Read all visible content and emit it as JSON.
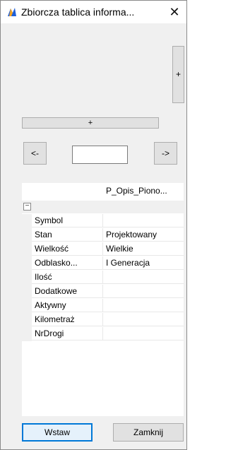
{
  "window": {
    "title": "Zbiorcza tablica informa...",
    "close_glyph": "✕",
    "icon": "app-sign-icon"
  },
  "controls": {
    "plus_right_label": "+",
    "plus_wide_label": "+",
    "prev_label": "<-",
    "next_label": "->",
    "page_input_value": ""
  },
  "grid": {
    "column_header": "P_Opis_Piono...",
    "collapse_glyph": "⊟",
    "rows": [
      {
        "label": "Symbol",
        "value": ""
      },
      {
        "label": "Stan",
        "value": "Projektowany"
      },
      {
        "label": "Wielkość",
        "value": "Wielkie"
      },
      {
        "label": "Odblasko...",
        "value": "I Generacja"
      },
      {
        "label": "Ilość",
        "value": ""
      },
      {
        "label": "Dodatkowe",
        "value": ""
      },
      {
        "label": "Aktywny",
        "value": ""
      },
      {
        "label": "Kilometraż",
        "value": ""
      },
      {
        "label": "NrDrogi",
        "value": ""
      }
    ]
  },
  "footer": {
    "insert_label": "Wstaw",
    "close_label": "Zamknij"
  },
  "colors": {
    "accent": "#0078d7",
    "button_face": "#e1e1e1",
    "window_bg": "#f0f0f0",
    "icon_blue": "#1e5fd8",
    "icon_orange": "#f5a623"
  }
}
